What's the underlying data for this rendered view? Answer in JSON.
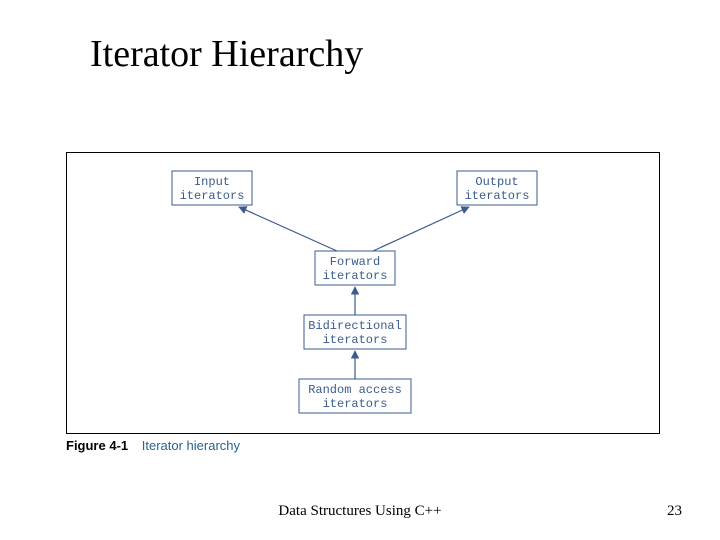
{
  "title": "Iterator Hierarchy",
  "figure": {
    "label": "Figure 4-1",
    "caption": "Iterator hierarchy"
  },
  "nodes": {
    "input": {
      "line1": "Input",
      "line2": "iterators"
    },
    "output": {
      "line1": "Output",
      "line2": "iterators"
    },
    "forward": {
      "line1": "Forward",
      "line2": "iterators"
    },
    "bidir": {
      "line1": "Bidirectional",
      "line2": "iterators"
    },
    "random": {
      "line1": "Random access",
      "line2": "iterators"
    }
  },
  "footer": {
    "center": "Data Structures Using C++",
    "page": "23"
  },
  "chart_data": {
    "type": "diagram",
    "title": "Iterator Hierarchy",
    "nodes": [
      {
        "id": "input",
        "label": "Input iterators"
      },
      {
        "id": "output",
        "label": "Output iterators"
      },
      {
        "id": "forward",
        "label": "Forward iterators"
      },
      {
        "id": "bidir",
        "label": "Bidirectional iterators"
      },
      {
        "id": "random",
        "label": "Random access iterators"
      }
    ],
    "edges": [
      {
        "from": "forward",
        "to": "input"
      },
      {
        "from": "forward",
        "to": "output"
      },
      {
        "from": "bidir",
        "to": "forward"
      },
      {
        "from": "random",
        "to": "bidir"
      }
    ],
    "edge_semantics": "arrow points from the more powerful iterator category toward the category it subsumes"
  }
}
